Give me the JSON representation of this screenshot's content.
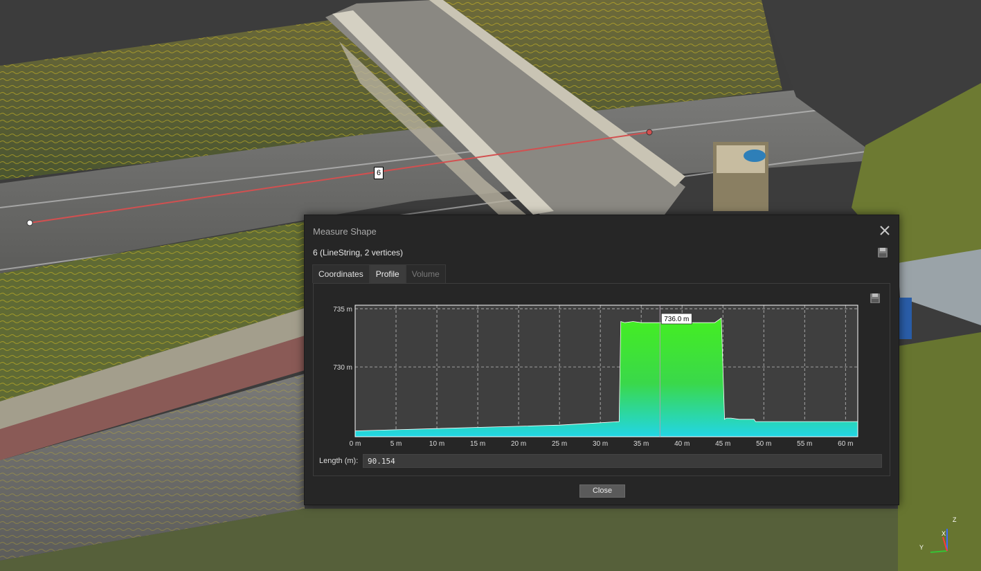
{
  "scene": {
    "marker_label": "6"
  },
  "dialog": {
    "title": "Measure Shape",
    "shape_label": "6 (LineString, 2 vertices)",
    "tabs": [
      {
        "label": "Coordinates",
        "state": "normal"
      },
      {
        "label": "Profile",
        "state": "active"
      },
      {
        "label": "Volume",
        "state": "disabled"
      }
    ],
    "length": {
      "label": "Length (m):",
      "value": "90.154"
    },
    "close_label": "Close",
    "close_icon": "close-icon",
    "save_icon": "save-icon"
  },
  "chart_data": {
    "type": "area",
    "title": "",
    "xlabel": "",
    "ylabel": "",
    "xlim": [
      0,
      61.5
    ],
    "ylim": [
      724,
      735.3
    ],
    "x_ticks": [
      "0 m",
      "5 m",
      "10 m",
      "15 m",
      "20 m",
      "25 m",
      "30 m",
      "35 m",
      "40 m",
      "45 m",
      "50 m",
      "55 m",
      "60 m"
    ],
    "y_ticks": [
      "730 m",
      "735 m"
    ],
    "grid": true,
    "tooltip": {
      "x": 37.3,
      "y": 736.0,
      "label": "736.0 m"
    },
    "x": [
      0,
      5,
      10,
      15,
      20,
      25,
      30,
      32.3,
      32.5,
      33,
      34,
      35,
      36,
      37,
      38,
      39,
      40,
      41,
      42,
      43,
      44,
      44.8,
      45.2,
      45.4,
      46,
      47,
      48,
      48.8,
      49,
      50,
      55,
      60,
      61.5
    ],
    "y": [
      724.5,
      724.6,
      724.7,
      724.8,
      724.9,
      725.0,
      725.2,
      725.3,
      733.9,
      733.8,
      733.9,
      733.8,
      733.8,
      733.8,
      733.8,
      733.8,
      733.8,
      733.8,
      733.8,
      733.8,
      733.8,
      734.2,
      725.5,
      725.6,
      725.6,
      725.5,
      725.5,
      725.5,
      725.3,
      725.3,
      725.3,
      725.3,
      725.3
    ]
  }
}
